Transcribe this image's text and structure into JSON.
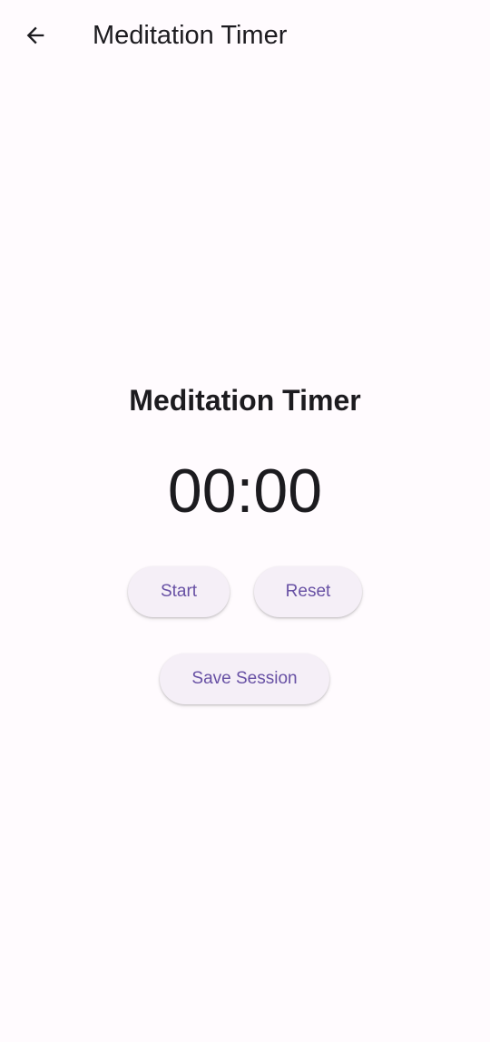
{
  "app_bar": {
    "back_icon": "arrow-back-icon",
    "title": "Meditation Timer"
  },
  "screen": {
    "title": "Meditation Timer",
    "timer": "00:00"
  },
  "actions": {
    "start_label": "Start",
    "reset_label": "Reset",
    "save_label": "Save Session"
  },
  "colors": {
    "background": "#fffbfe",
    "text": "#1c1b1f",
    "button_background": "#f5eff7",
    "button_text": "#6750a4"
  }
}
